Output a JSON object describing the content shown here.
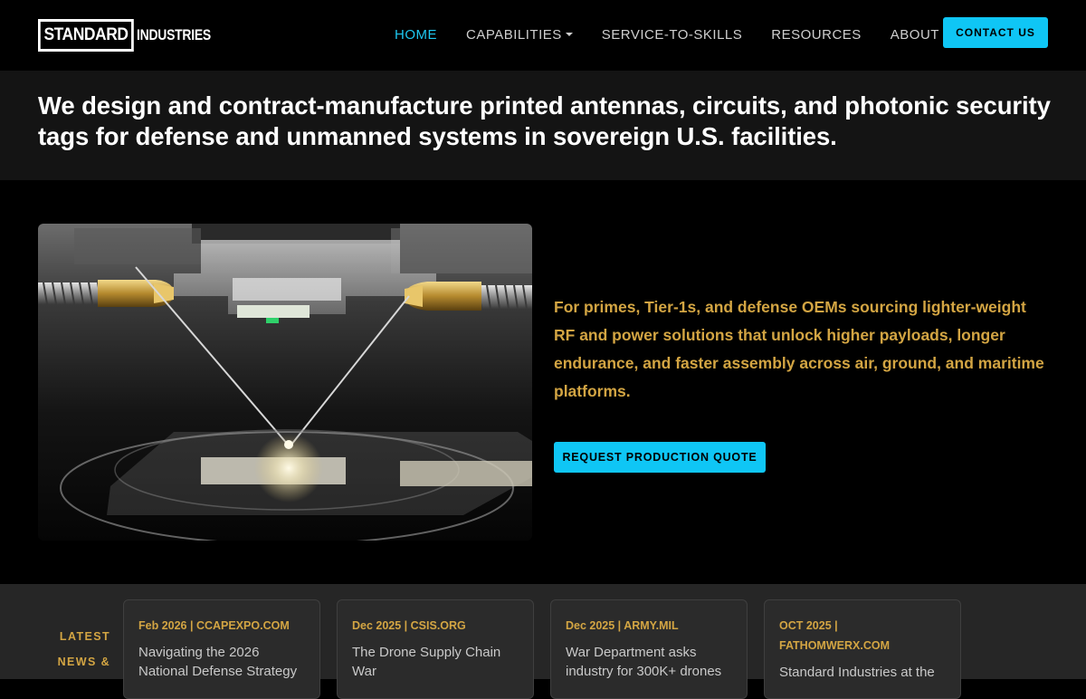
{
  "header": {
    "logo": {
      "main": "STANDARD",
      "sub": "INDUSTRIES"
    },
    "nav": [
      {
        "label": "HOME",
        "active": true
      },
      {
        "label": "CAPABILITIES",
        "dropdown": true
      },
      {
        "label": "SERVICE-TO-SKILLS"
      },
      {
        "label": "RESOURCES"
      },
      {
        "label": "ABOUT"
      }
    ],
    "contact_button": "CONTACT US"
  },
  "hero": {
    "headline": "We design and contract-manufacture printed antennas, circuits, and photonic security tags for defense and unmanned systems in sovereign U.S. facilities."
  },
  "feature": {
    "text": "For primes, Tier-1s, and defense OEMs sourcing lighter-weight RF and power solutions that unlock higher payloads, longer endurance, and faster assembly across air, ground, and maritime platforms.",
    "cta_label": "REQUEST PRODUCTION QUOTE"
  },
  "news": {
    "label": "LATEST NEWS &",
    "cards": [
      {
        "meta": "Feb 2026 | CCAPEXPO.COM",
        "title": "Navigating the 2026 National Defense Strategy"
      },
      {
        "meta": "Dec 2025 | CSIS.ORG",
        "title": "The Drone Supply Chain War"
      },
      {
        "meta": "Dec 2025 | ARMY.MIL",
        "title": "War Department asks industry for 300K+ drones"
      },
      {
        "meta": "OCT 2025 | FATHOMWERX.COM",
        "title": "Standard Industries at the"
      }
    ]
  },
  "colors": {
    "accent": "#0fc6f5",
    "nav_active": "#1ec8f0",
    "gold": "#d3a543",
    "hero_band": "#141414",
    "news_band": "#262626"
  }
}
